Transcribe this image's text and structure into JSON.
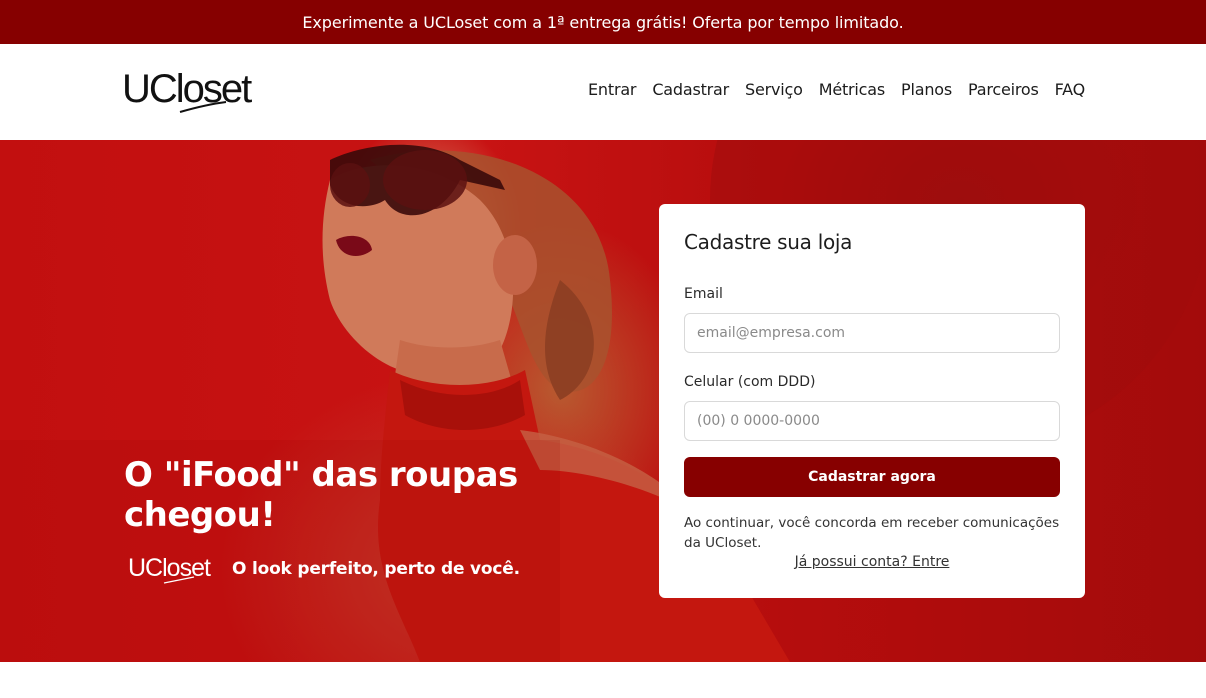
{
  "promo": {
    "text": "Experimente a UCLoset com a 1ª entrega grátis! Oferta por tempo limitado."
  },
  "header": {
    "logo_text": "UCloset",
    "nav": [
      "Entrar",
      "Cadastrar",
      "Serviço",
      "Métricas",
      "Planos",
      "Parceiros",
      "FAQ"
    ]
  },
  "hero": {
    "title": "O \"iFood\" das roupas chegou!",
    "sub_logo_text": "UCloset",
    "subtitle": "O look perfeito, perto de você."
  },
  "signup": {
    "title": "Cadastre sua loja",
    "email_label": "Email",
    "email_placeholder": "email@empresa.com",
    "phone_label": "Celular (com DDD)",
    "phone_placeholder": "(00) 0 0000-0000",
    "submit_label": "Cadastrar agora",
    "consent_text": "Ao continuar, você concorda em receber comunicações da UCloset.",
    "login_link": "Já possui conta? Entre"
  },
  "colors": {
    "brand": "#860000",
    "hero_red": "#c20f0f",
    "button": "#870000"
  },
  "icons": {
    "logo": "ucloset-logo",
    "hero_image": "woman-with-sunglasses-photo"
  }
}
